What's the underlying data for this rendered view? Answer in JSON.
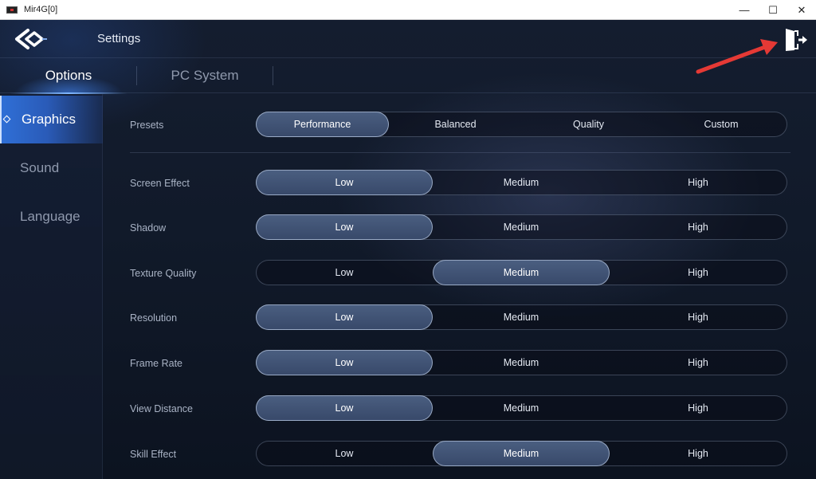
{
  "window": {
    "title": "Mir4G[0]",
    "minimize_glyph": "—",
    "maximize_glyph": "☐",
    "close_glyph": "✕"
  },
  "header": {
    "title": "Settings",
    "exit_icon": "exit-door-icon"
  },
  "tabs": [
    {
      "label": "Options",
      "active": true
    },
    {
      "label": "PC System",
      "active": false
    }
  ],
  "sidebar": {
    "items": [
      {
        "label": "Graphics",
        "active": true
      },
      {
        "label": "Sound",
        "active": false
      },
      {
        "label": "Language",
        "active": false
      }
    ]
  },
  "presets": {
    "label": "Presets",
    "options": [
      "Performance",
      "Balanced",
      "Quality",
      "Custom"
    ],
    "selected": "Performance"
  },
  "settings": [
    {
      "label": "Screen Effect",
      "options": [
        "Low",
        "Medium",
        "High"
      ],
      "selected": "Low"
    },
    {
      "label": "Shadow",
      "options": [
        "Low",
        "Medium",
        "High"
      ],
      "selected": "Low"
    },
    {
      "label": "Texture Quality",
      "options": [
        "Low",
        "Medium",
        "High"
      ],
      "selected": "Medium"
    },
    {
      "label": "Resolution",
      "options": [
        "Low",
        "Medium",
        "High"
      ],
      "selected": "Low"
    },
    {
      "label": "Frame Rate",
      "options": [
        "Low",
        "Medium",
        "High"
      ],
      "selected": "Low"
    },
    {
      "label": "View Distance",
      "options": [
        "Low",
        "Medium",
        "High"
      ],
      "selected": "Low"
    },
    {
      "label": "Skill Effect",
      "options": [
        "Low",
        "Medium",
        "High"
      ],
      "selected": "Medium"
    }
  ],
  "colors": {
    "accent": "#2f6fd6",
    "annotation_arrow": "#e53935"
  }
}
